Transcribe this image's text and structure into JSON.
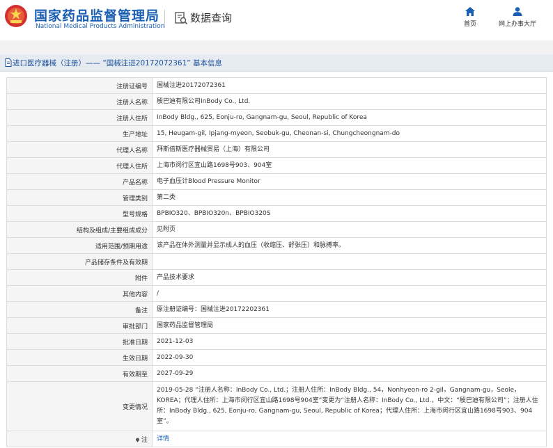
{
  "header": {
    "brand_cn": "国家药品监督管理局",
    "brand_en": "National Medical Products Administration",
    "query_title": "数据查询",
    "nav": [
      {
        "label": "首页",
        "icon": "home-icon"
      },
      {
        "label": "网上办事大厅",
        "icon": "user-icon"
      }
    ]
  },
  "breadcrumb": "进口医疗器械（注册）—— “国械注进20172072361” 基本信息",
  "rows": [
    {
      "label": "注册证编号",
      "value": "国械注进20172072361"
    },
    {
      "label": "注册人名称",
      "value": "殷巴迪有限公司InBody Co., Ltd."
    },
    {
      "label": "注册人住所",
      "value": "InBody Bldg., 625, Eonju-ro, Gangnam-gu, Seoul, Republic of Korea"
    },
    {
      "label": "生产地址",
      "value": "15, Heugam-gil, Ipjang-myeon, Seobuk-gu, Cheonan-si, Chungcheongnam-do"
    },
    {
      "label": "代理人名称",
      "value": "拜斯倍斯医疗器械贸易（上海）有限公司"
    },
    {
      "label": "代理人住所",
      "value": "上海市闵行区宜山路1698号903、904室"
    },
    {
      "label": "产品名称",
      "value": "电子血压计Blood Pressure Monitor"
    },
    {
      "label": "管理类别",
      "value": "第二类"
    },
    {
      "label": "型号规格",
      "value": "BPBIO320、BPBIO320n、BPBIO320S"
    },
    {
      "label": "结构及组成/主要组成成分",
      "value": "见附页"
    },
    {
      "label": "适用范围/预期用途",
      "value": "该产品在体外测量并显示成人的血压（收缩压、舒张压）和脉搏率。"
    },
    {
      "label": "产品储存条件及有效期",
      "value": ""
    },
    {
      "label": "附件",
      "value": "产品技术要求"
    },
    {
      "label": "其他内容",
      "value": "/"
    },
    {
      "label": "备注",
      "value": "原注册证编号：国械注进20172202361"
    },
    {
      "label": "审批部门",
      "value": "国家药品监督管理局"
    },
    {
      "label": "批准日期",
      "value": "2021-12-03"
    },
    {
      "label": "生效日期",
      "value": "2022-09-30"
    },
    {
      "label": "有效期至",
      "value": "2027-09-29"
    },
    {
      "label": "变更情况",
      "value": "2019-05-28 “注册人名称：InBody Co., Ltd.；注册人住所：InBody Bldg., 54，Nonhyeon-ro 2-gil，Gangnam-gu，Seole，KOREA；代理人住所：上海市闵行区宜山路1698号904室”变更为“注册人名称：InBody Co., Ltd.，中文：“殷巴迪有限公司”；注册人住所：InBody Bldg., 625, Eonju-ro, Gangnam-gu, Seoul, Republic of Korea；代理人住所：上海市闵行区宜山路1698号903、904室”。"
    },
    {
      "label": "注",
      "value": "详情"
    }
  ],
  "colors": {
    "brand": "#1a5fb4",
    "header_red": "#d32f2f"
  }
}
